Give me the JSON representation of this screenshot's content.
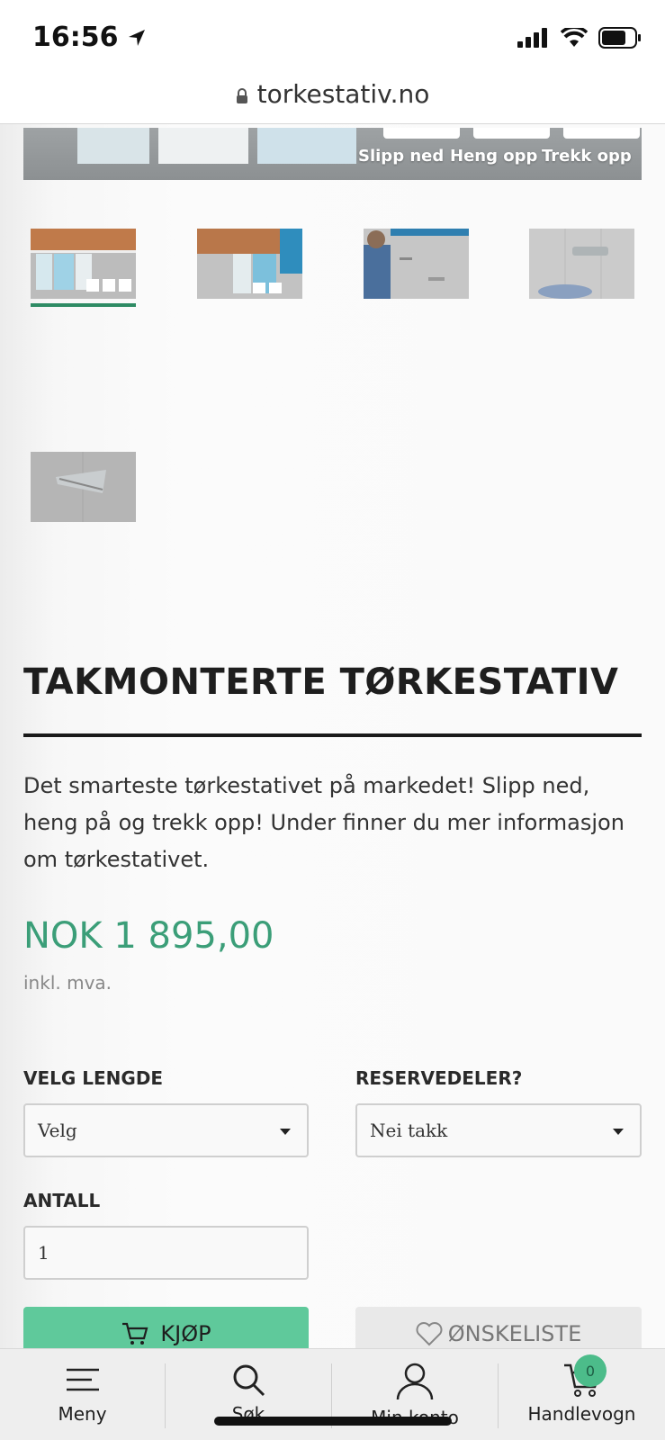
{
  "status_bar": {
    "time": "16:56"
  },
  "browser": {
    "url": "torkestativ.no"
  },
  "hero": {
    "tags": [
      "Slipp ned",
      "Heng opp",
      "Trekk opp"
    ]
  },
  "product": {
    "title": "TAKMONTERTE TØRKESTATIV",
    "description": "Det smarteste tørkestativet på markedet! Slipp ned, heng på og trekk opp! Under finner du mer informasjon om tørkestativet.",
    "price": "NOK 1 895,00",
    "vat_note": "inkl. mva."
  },
  "options": {
    "length_label": "VELG LENGDE",
    "length_value": "Velg",
    "parts_label": "RESERVEDELER?",
    "parts_value": "Nei takk",
    "quantity_label": "ANTALL",
    "quantity_value": "1"
  },
  "actions": {
    "buy_label": "KJØP",
    "wishlist_label": "ØNSKELISTE"
  },
  "bottom_nav": {
    "menu": "Meny",
    "search": "Søk",
    "account": "Min konto",
    "cart": "Handlevogn",
    "cart_count": "0"
  },
  "colors": {
    "accent": "#3b9e78",
    "buy_button": "#5fc99b",
    "badge": "#4cbc8a"
  }
}
